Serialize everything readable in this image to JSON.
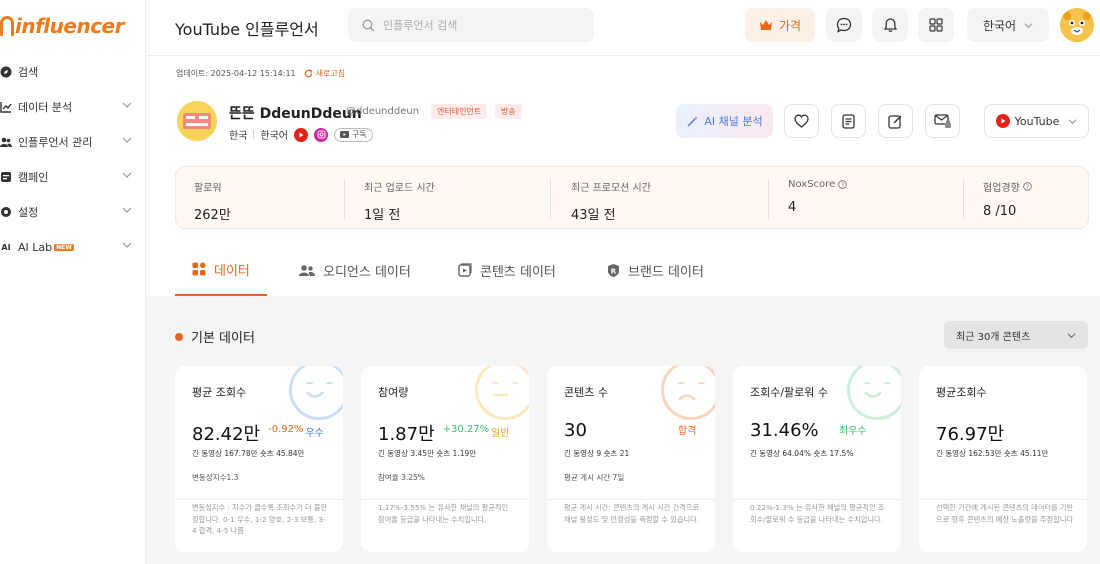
{
  "brand": {
    "logo_text": "influencer",
    "accent": "#f07a1a"
  },
  "sidebar": {
    "items": [
      {
        "label": "검색",
        "icon": "compass-icon"
      },
      {
        "label": "데이터 분석",
        "icon": "chart-icon"
      },
      {
        "label": "인플루언서 관리",
        "icon": "users-icon"
      },
      {
        "label": "캠페인",
        "icon": "campaign-icon"
      },
      {
        "label": "설정",
        "icon": "gear-icon"
      },
      {
        "label": "AI Lab",
        "icon": "ai-icon",
        "badge": "NEW"
      }
    ]
  },
  "header": {
    "title": "YouTube 인플루언서",
    "search_placeholder": "인플루언서 검색",
    "price_label": "가격",
    "language": "한국어"
  },
  "update": {
    "label": "업데이트: 2025-04-12 15:14:11",
    "refresh": "새로고침"
  },
  "profile": {
    "name": "뜬뜬 DdeunDdeun",
    "handle": "@ddeunddeun",
    "tags": [
      "엔터테인먼트",
      "방송"
    ],
    "country": "한국",
    "language": "한국어",
    "subscribe": "구독",
    "ai_button": "AI 채널 분석",
    "platform": "YouTube"
  },
  "stats": [
    {
      "label": "팔로워",
      "value": "262만"
    },
    {
      "label": "최근 업로드 시간",
      "value": "1일 전"
    },
    {
      "label": "최근 프로모션 시간",
      "value": "43일 전"
    },
    {
      "label": "NoxScore",
      "value": "4",
      "info": true
    },
    {
      "label": "협업경향",
      "value": "8 /10",
      "info": true
    }
  ],
  "tabs": [
    {
      "label": "데이터",
      "icon": "grid-icon"
    },
    {
      "label": "오디언스 데이터",
      "icon": "audience-icon"
    },
    {
      "label": "콘텐츠 데이터",
      "icon": "content-icon"
    },
    {
      "label": "브랜드 데이터",
      "icon": "brand-icon"
    }
  ],
  "section": {
    "title": "기본 데이터",
    "range": "최근 30개 콘텐츠"
  },
  "cards": [
    {
      "title": "평균 조회수",
      "value": "82.42만",
      "change": "-0.92%",
      "change_color": "#e8651a",
      "grade": "우수",
      "grade_color": "#3a7be0",
      "sub": "긴 동영상 167.78만  숏츠 45.84만",
      "sub2": "변동성지수1.3",
      "desc": "변동성지수 : 지수가 클수록 조회수가 더 불안정합니다. 0-1 우수, 1-2 양호, 2-3 보통, 3-4 합격, 4-5 나쁨",
      "face_color": "#6aa3e8",
      "mood": "happy"
    },
    {
      "title": "참여량",
      "value": "1.87만",
      "change": "+30.27%",
      "change_color": "#3dbb6b",
      "grade": "일반",
      "grade_color": "#e8a21a",
      "sub": "긴 동영상 3.45만  숏츠 1.19만",
      "sub2": "참여율 3.25%",
      "desc": "1.17%-3.55% 는 유사한 채널의 평균적인 참여율 등급을 나타내는 수치입니다.",
      "face_color": "#f2c14a",
      "mood": "neutral"
    },
    {
      "title": "콘텐츠 수",
      "value": "30",
      "change": "",
      "change_color": "#222",
      "grade": "합격",
      "grade_color": "#e8651a",
      "sub": "긴 동영상 9  숏츠 21",
      "sub2": "평균 게시 시간 7일",
      "desc": "평균 게시 시간: 콘텐츠의 게시 시간 간격으로 채널 활성도 및 안정성을 측정할 수 있습니다.",
      "face_color": "#f08a4a",
      "mood": "sad"
    },
    {
      "title": "조회수/팔로워 수",
      "value": "31.46%",
      "change": "",
      "change_color": "#222",
      "grade": "최우수",
      "grade_color": "#3dbb6b",
      "sub": "긴 동영상 64.04%  숏츠 17.5%",
      "sub2": "",
      "desc": "0.22%-1.3% 는 유사한 채널의 평균적인 조회수/팔로워 수 등급을 나타내는 수치입니다.",
      "face_color": "#6fd39a",
      "mood": "happy"
    },
    {
      "title": "평균조회수",
      "value": "76.97만",
      "change": "",
      "change_color": "#222",
      "grade": "",
      "grade_color": "#222",
      "sub": "긴 동영상 162.53만  숏츠 45.11만",
      "sub2": "",
      "desc": "선택한 기간에 게시된 콘텐츠의 데이터를 기반으로 향후 콘텐츠의 예상 노출량을 추정합니다",
      "face_color": "#ffffff",
      "mood": "none"
    }
  ]
}
